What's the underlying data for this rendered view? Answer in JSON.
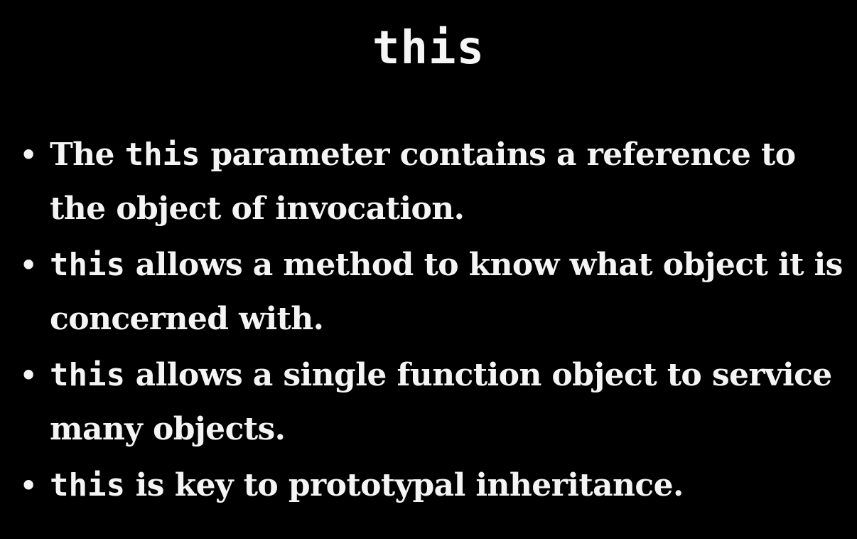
{
  "slide": {
    "title": "this",
    "bullet_marker": "•",
    "bullets": [
      {
        "code_prefix": "",
        "pre_text": "The ",
        "code_inline": "this",
        "text": " parameter contains a reference to the object of invocation."
      },
      {
        "code_prefix": "this",
        "pre_text": "",
        "code_inline": "",
        "text": " allows a method to know what object it is concerned with."
      },
      {
        "code_prefix": "this",
        "pre_text": "",
        "code_inline": "",
        "text": " allows a single function object to service many objects."
      },
      {
        "code_prefix": "this",
        "pre_text": "",
        "code_inline": "",
        "text": " is key to prototypal inheritance."
      }
    ]
  },
  "colors": {
    "background": "#000000",
    "text": "#f4f4f4"
  }
}
